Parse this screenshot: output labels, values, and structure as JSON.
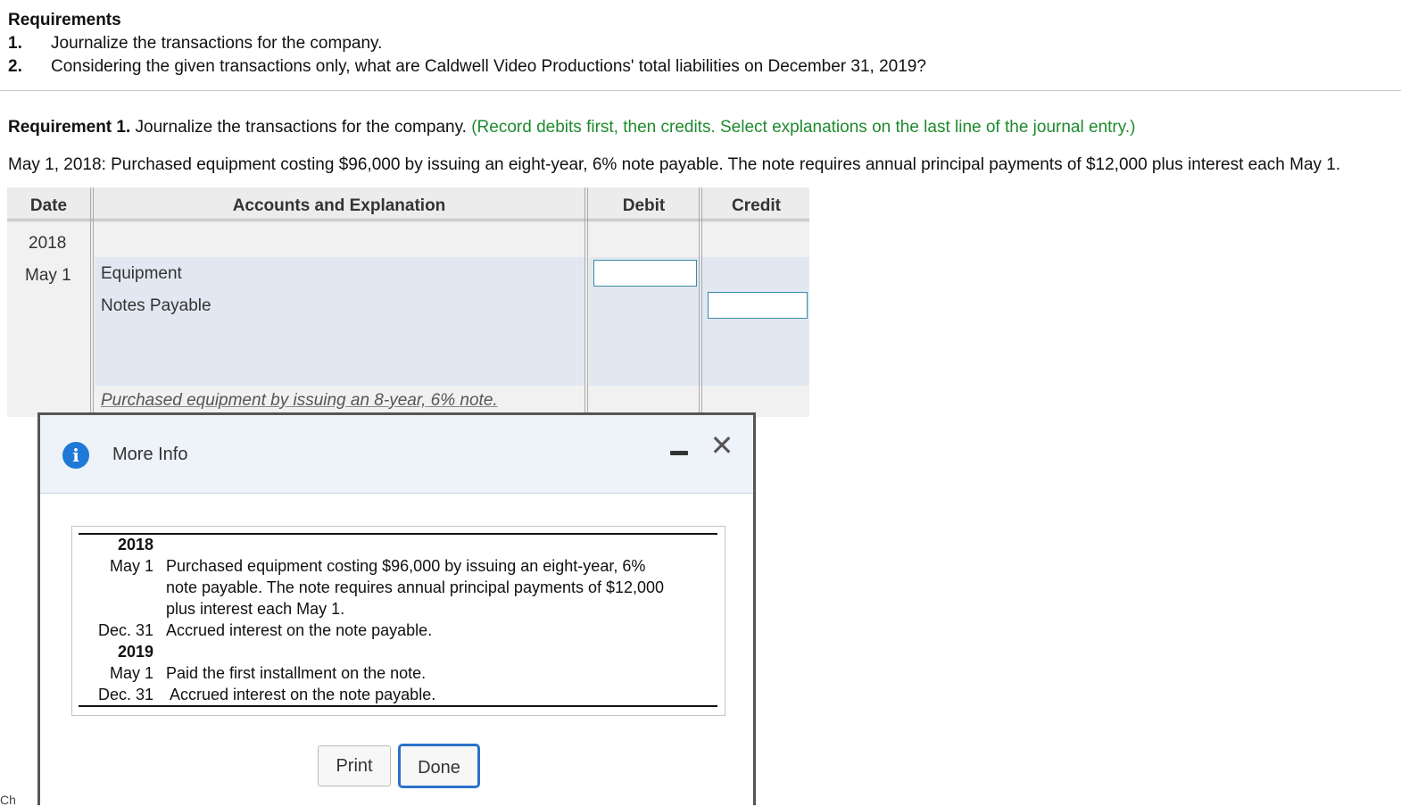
{
  "requirements": {
    "title": "Requirements",
    "items": [
      {
        "num": "1.",
        "text": "Journalize the transactions for the company."
      },
      {
        "num": "2.",
        "text": "Considering the given transactions only, what are Caldwell Video Productions' total liabilities on December 31, 2019?"
      }
    ]
  },
  "requirement1": {
    "label": "Requirement 1.",
    "text": " Journalize the transactions for the company. ",
    "instruction": "(Record debits first, then credits. Select explanations on the last line of the journal entry.)"
  },
  "transaction": "May 1, 2018: Purchased equipment costing $96,000 by issuing an eight-year, 6% note payable. The note requires annual principal payments of $12,000 plus interest each May 1.",
  "journal": {
    "headers": {
      "date": "Date",
      "accounts": "Accounts and Explanation",
      "debit": "Debit",
      "credit": "Credit"
    },
    "year": "2018",
    "date": "May 1",
    "debit_account": "Equipment",
    "credit_account": "Notes Payable",
    "debit_value": "",
    "credit_value": "",
    "explanation": "Purchased equipment by issuing an 8-year, 6% note."
  },
  "modal": {
    "title": "More Info",
    "rows": [
      {
        "date": "2018",
        "year": true,
        "text": ""
      },
      {
        "date": "May 1",
        "year": false,
        "text": "Purchased equipment costing $96,000 by issuing an eight-year, 6%"
      },
      {
        "date": "",
        "year": false,
        "text": "note payable. The note requires annual principal payments of $12,000"
      },
      {
        "date": "",
        "year": false,
        "text": "plus interest each May 1."
      },
      {
        "date": "Dec. 31",
        "year": false,
        "text": "Accrued interest on the note payable."
      },
      {
        "date": "2019",
        "year": true,
        "text": ""
      },
      {
        "date": "May 1",
        "year": false,
        "text": "Paid the first installment on the note."
      },
      {
        "date": "Dec. 31",
        "year": false,
        "text": " Accrued interest on the note payable."
      }
    ],
    "print_label": "Print",
    "done_label": "Done"
  },
  "stray_text": "Ch",
  "colors": {
    "instruction": "#1f8a2e",
    "info_icon": "#1e7ad6",
    "done_border": "#2a72c9",
    "input_border": "#3b8ca8"
  }
}
